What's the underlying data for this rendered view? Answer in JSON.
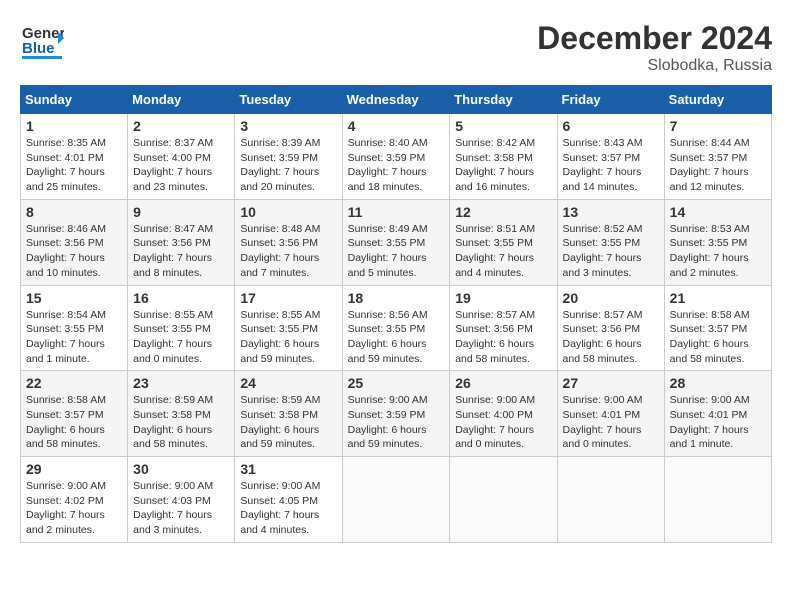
{
  "logo": {
    "line1": "General",
    "line2": "Blue"
  },
  "title": "December 2024",
  "subtitle": "Slobodka, Russia",
  "days_of_week": [
    "Sunday",
    "Monday",
    "Tuesday",
    "Wednesday",
    "Thursday",
    "Friday",
    "Saturday"
  ],
  "weeks": [
    [
      {
        "day": "1",
        "info": "Sunrise: 8:35 AM\nSunset: 4:01 PM\nDaylight: 7 hours\nand 25 minutes."
      },
      {
        "day": "2",
        "info": "Sunrise: 8:37 AM\nSunset: 4:00 PM\nDaylight: 7 hours\nand 23 minutes."
      },
      {
        "day": "3",
        "info": "Sunrise: 8:39 AM\nSunset: 3:59 PM\nDaylight: 7 hours\nand 20 minutes."
      },
      {
        "day": "4",
        "info": "Sunrise: 8:40 AM\nSunset: 3:59 PM\nDaylight: 7 hours\nand 18 minutes."
      },
      {
        "day": "5",
        "info": "Sunrise: 8:42 AM\nSunset: 3:58 PM\nDaylight: 7 hours\nand 16 minutes."
      },
      {
        "day": "6",
        "info": "Sunrise: 8:43 AM\nSunset: 3:57 PM\nDaylight: 7 hours\nand 14 minutes."
      },
      {
        "day": "7",
        "info": "Sunrise: 8:44 AM\nSunset: 3:57 PM\nDaylight: 7 hours\nand 12 minutes."
      }
    ],
    [
      {
        "day": "8",
        "info": "Sunrise: 8:46 AM\nSunset: 3:56 PM\nDaylight: 7 hours\nand 10 minutes."
      },
      {
        "day": "9",
        "info": "Sunrise: 8:47 AM\nSunset: 3:56 PM\nDaylight: 7 hours\nand 8 minutes."
      },
      {
        "day": "10",
        "info": "Sunrise: 8:48 AM\nSunset: 3:56 PM\nDaylight: 7 hours\nand 7 minutes."
      },
      {
        "day": "11",
        "info": "Sunrise: 8:49 AM\nSunset: 3:55 PM\nDaylight: 7 hours\nand 5 minutes."
      },
      {
        "day": "12",
        "info": "Sunrise: 8:51 AM\nSunset: 3:55 PM\nDaylight: 7 hours\nand 4 minutes."
      },
      {
        "day": "13",
        "info": "Sunrise: 8:52 AM\nSunset: 3:55 PM\nDaylight: 7 hours\nand 3 minutes."
      },
      {
        "day": "14",
        "info": "Sunrise: 8:53 AM\nSunset: 3:55 PM\nDaylight: 7 hours\nand 2 minutes."
      }
    ],
    [
      {
        "day": "15",
        "info": "Sunrise: 8:54 AM\nSunset: 3:55 PM\nDaylight: 7 hours\nand 1 minute."
      },
      {
        "day": "16",
        "info": "Sunrise: 8:55 AM\nSunset: 3:55 PM\nDaylight: 7 hours\nand 0 minutes."
      },
      {
        "day": "17",
        "info": "Sunrise: 8:55 AM\nSunset: 3:55 PM\nDaylight: 6 hours\nand 59 minutes."
      },
      {
        "day": "18",
        "info": "Sunrise: 8:56 AM\nSunset: 3:55 PM\nDaylight: 6 hours\nand 59 minutes."
      },
      {
        "day": "19",
        "info": "Sunrise: 8:57 AM\nSunset: 3:56 PM\nDaylight: 6 hours\nand 58 minutes."
      },
      {
        "day": "20",
        "info": "Sunrise: 8:57 AM\nSunset: 3:56 PM\nDaylight: 6 hours\nand 58 minutes."
      },
      {
        "day": "21",
        "info": "Sunrise: 8:58 AM\nSunset: 3:57 PM\nDaylight: 6 hours\nand 58 minutes."
      }
    ],
    [
      {
        "day": "22",
        "info": "Sunrise: 8:58 AM\nSunset: 3:57 PM\nDaylight: 6 hours\nand 58 minutes."
      },
      {
        "day": "23",
        "info": "Sunrise: 8:59 AM\nSunset: 3:58 PM\nDaylight: 6 hours\nand 58 minutes."
      },
      {
        "day": "24",
        "info": "Sunrise: 8:59 AM\nSunset: 3:58 PM\nDaylight: 6 hours\nand 59 minutes."
      },
      {
        "day": "25",
        "info": "Sunrise: 9:00 AM\nSunset: 3:59 PM\nDaylight: 6 hours\nand 59 minutes."
      },
      {
        "day": "26",
        "info": "Sunrise: 9:00 AM\nSunset: 4:00 PM\nDaylight: 7 hours\nand 0 minutes."
      },
      {
        "day": "27",
        "info": "Sunrise: 9:00 AM\nSunset: 4:01 PM\nDaylight: 7 hours\nand 0 minutes."
      },
      {
        "day": "28",
        "info": "Sunrise: 9:00 AM\nSunset: 4:01 PM\nDaylight: 7 hours\nand 1 minute."
      }
    ],
    [
      {
        "day": "29",
        "info": "Sunrise: 9:00 AM\nSunset: 4:02 PM\nDaylight: 7 hours\nand 2 minutes."
      },
      {
        "day": "30",
        "info": "Sunrise: 9:00 AM\nSunset: 4:03 PM\nDaylight: 7 hours\nand 3 minutes."
      },
      {
        "day": "31",
        "info": "Sunrise: 9:00 AM\nSunset: 4:05 PM\nDaylight: 7 hours\nand 4 minutes."
      },
      {
        "day": "",
        "info": ""
      },
      {
        "day": "",
        "info": ""
      },
      {
        "day": "",
        "info": ""
      },
      {
        "day": "",
        "info": ""
      }
    ]
  ]
}
